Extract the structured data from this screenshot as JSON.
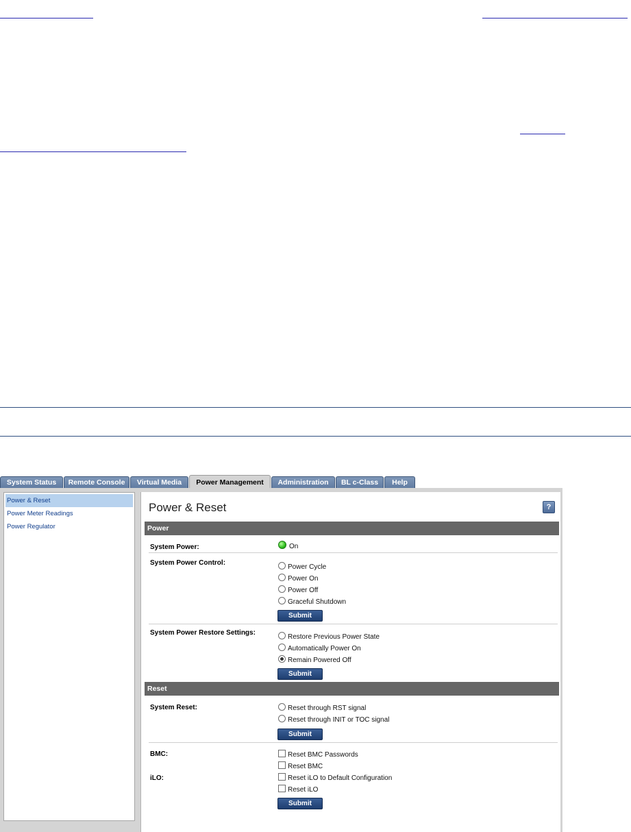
{
  "document": {
    "top_link_1": "",
    "top_link_2": ""
  },
  "tabs": [
    {
      "label": "System Status"
    },
    {
      "label": "Remote Console"
    },
    {
      "label": "Virtual Media"
    },
    {
      "label": "Power Management",
      "active": true
    },
    {
      "label": "Administration"
    },
    {
      "label": "BL c-Class"
    },
    {
      "label": "Help"
    }
  ],
  "sidebar": {
    "items": [
      {
        "label": "Power & Reset",
        "active": true
      },
      {
        "label": "Power Meter Readings"
      },
      {
        "label": "Power Regulator"
      }
    ]
  },
  "main": {
    "title": "Power & Reset",
    "help_icon": "?",
    "power_section": {
      "header": "Power",
      "system_power_label": "System Power:",
      "system_power_status": "On",
      "system_power_status_color": "#2fbf1e",
      "control_label": "System Power Control:",
      "control_options": [
        "Power Cycle",
        "Power On",
        "Power Off",
        "Graceful Shutdown"
      ],
      "restore_label": "System Power Restore Settings:",
      "restore_options": [
        "Restore Previous Power State",
        "Automatically Power On",
        "Remain Powered Off"
      ],
      "restore_selected": "Remain Powered Off"
    },
    "reset_section": {
      "header": "Reset",
      "system_reset_label": "System Reset:",
      "system_reset_options": [
        "Reset through RST signal",
        "Reset through INIT or TOC signal"
      ],
      "bmc_label": "BMC:",
      "ilo_label": "iLO:",
      "checkbox_options": [
        "Reset BMC Passwords",
        "Reset BMC",
        "Reset iLO to Default Configuration",
        "Reset iLO"
      ]
    },
    "submit_label": "Submit"
  }
}
